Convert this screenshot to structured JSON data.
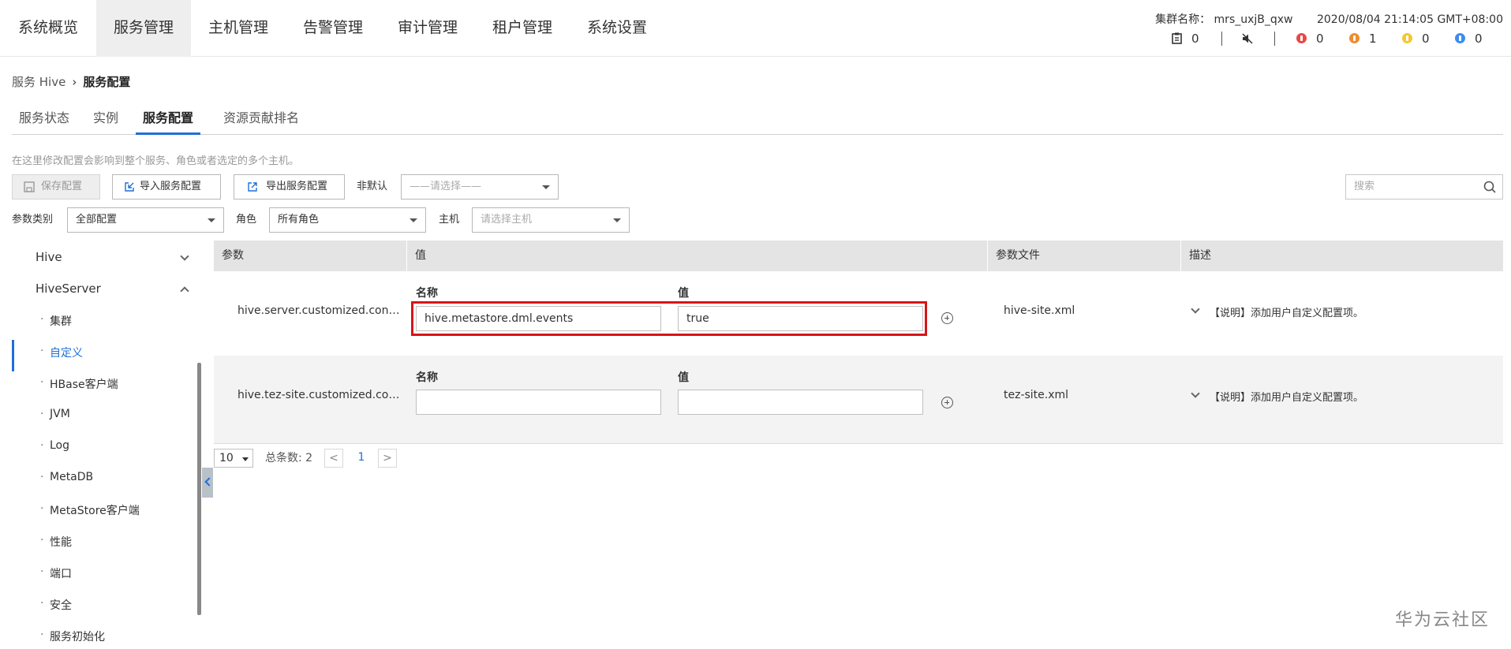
{
  "nav": {
    "items": [
      "系统概览",
      "服务管理",
      "主机管理",
      "告警管理",
      "审计管理",
      "租户管理",
      "系统设置"
    ],
    "active": "服务管理"
  },
  "cluster": {
    "name_label": "集群名称：",
    "name": "mrs_uxjB_qxw",
    "datetime": "2020/08/04 21:14:05 GMT+08:00"
  },
  "status": {
    "tasks": "0",
    "critical": "0",
    "major": "1",
    "minor": "0",
    "info": "0"
  },
  "breadcrumb": {
    "parent": "服务 Hive",
    "separator": "›",
    "current": "服务配置"
  },
  "tabs": [
    "服务状态",
    "实例",
    "服务配置",
    "资源贡献排名"
  ],
  "hint": "在这里修改配置会影响到整个服务、角色或者选定的多个主机。",
  "toolbar": {
    "save": "保存配置",
    "import": "导入服务配置",
    "export": "导出服务配置",
    "non_default_label": "非默认",
    "non_default_placeholder": "——请选择——",
    "search_placeholder": "搜索"
  },
  "filters": {
    "category_label": "参数类别",
    "category_value": "全部配置",
    "role_label": "角色",
    "role_value": "所有角色",
    "host_label": "主机",
    "host_placeholder": "请选择主机"
  },
  "sidebar": {
    "groups": [
      {
        "label": "Hive"
      },
      {
        "label": "HiveServer"
      }
    ],
    "sub_items": [
      "集群",
      "自定义",
      "HBase客户端",
      "JVM",
      "Log",
      "MetaDB",
      "MetaStore客户端",
      "性能",
      "端口",
      "安全",
      "服务初始化"
    ],
    "active": "自定义"
  },
  "table": {
    "headers": [
      "参数",
      "值",
      "参数文件",
      "描述"
    ],
    "name_label": "名称",
    "value_label": "值",
    "rows": [
      {
        "param": "hive.server.customized.configs",
        "name": "hive.metastore.dml.events",
        "value": "true",
        "file": "hive-site.xml",
        "desc": "【说明】添加用户自定义配置项。"
      },
      {
        "param": "hive.tez-site.customized.conf...",
        "name": "",
        "value": "",
        "file": "tez-site.xml",
        "desc": "【说明】添加用户自定义配置项。"
      }
    ]
  },
  "pager": {
    "size": "10",
    "total": "总条数: 2",
    "prev": "<",
    "current": "1",
    "next": ">"
  },
  "watermark": "华为云社区",
  "colors": {
    "accent": "#1e6fd9",
    "highlight_border": "#d81418",
    "nav_active_bg": "#eeeeee",
    "table_header_bg": "#e4e4e4"
  }
}
